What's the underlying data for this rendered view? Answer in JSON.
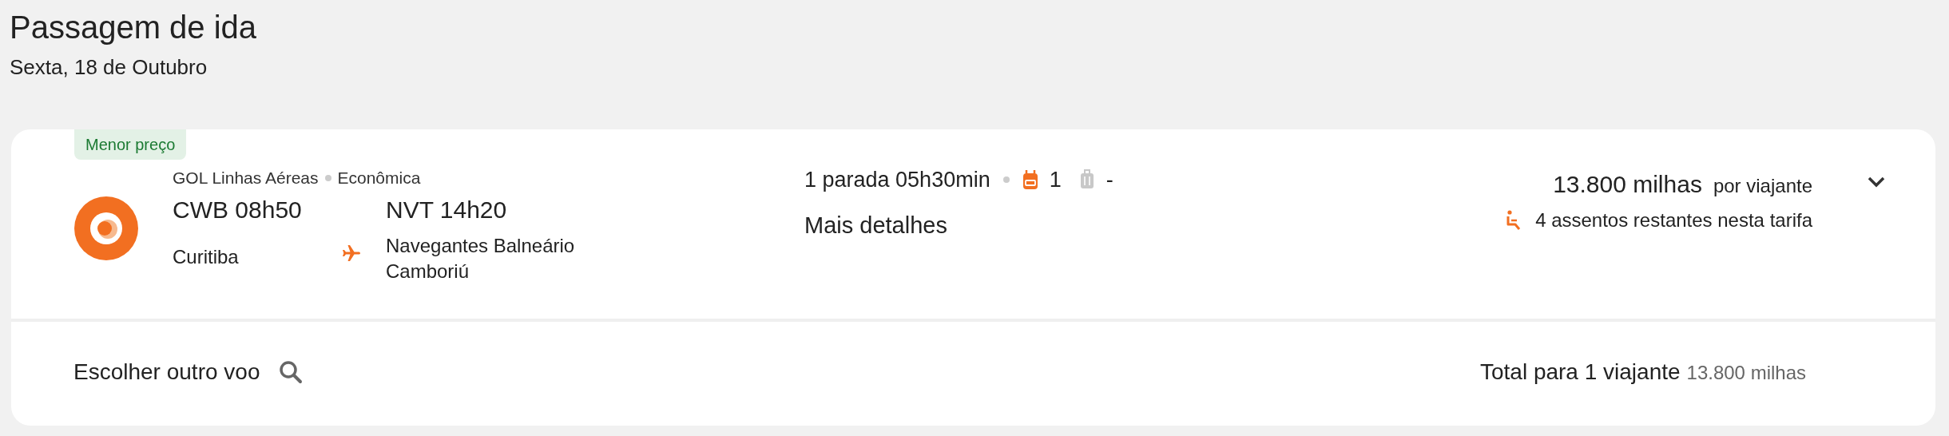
{
  "header": {
    "title": "Passagem de ida",
    "date": "Sexta, 18 de Outubro"
  },
  "flight": {
    "badge": "Menor preço",
    "airline": "GOL Linhas Aéreas",
    "cabin": "Econômica",
    "origin": {
      "code_time": "CWB 08h50",
      "city": "Curitiba"
    },
    "destination": {
      "code_time": "NVT 14h20",
      "city": "Navegantes Balneário Camboriú"
    },
    "stops": "1 parada 05h30min",
    "baggage": [
      {
        "kind": "backpack",
        "included": true,
        "count": "1"
      },
      {
        "kind": "suitcase",
        "included": false,
        "count": "-"
      }
    ],
    "details_link": "Mais detalhes",
    "price": "13.800 milhas",
    "price_unit": "por viajante",
    "seats": "4 assentos restantes nesta tarifa",
    "expanded": false
  },
  "footer": {
    "other_flight": "Escolher outro voo",
    "total_label": "Total para 1 viajante",
    "total_value": "13.800 milhas"
  }
}
